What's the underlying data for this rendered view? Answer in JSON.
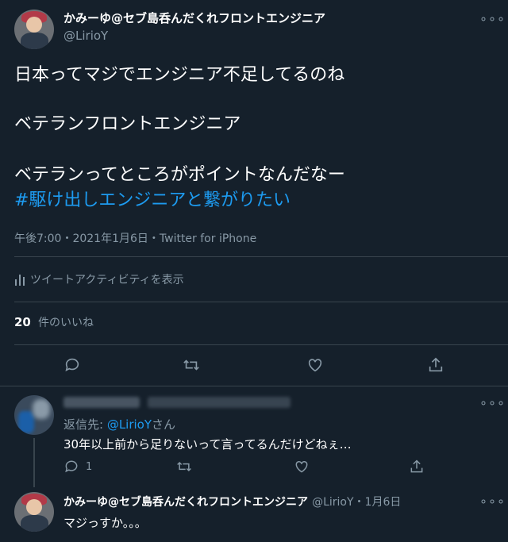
{
  "tweet": {
    "author_name": "かみーゆ@セブ島呑んだくれフロントエンジニア",
    "author_handle": "@LirioY",
    "more_icon": "more-horizontal-icon",
    "lines": [
      "日本ってマジでエンジニア不足してるのね",
      "ベテランフロントエンジニア",
      "ベテランってところがポイントなんだなー"
    ],
    "hashtag": "#駆け出しエンジニアと繋がりたい",
    "timestamp": "午後7:00・2021年1月6日・Twitter for iPhone",
    "activity_label": "ツイートアクティビティを表示",
    "likes_count": "20",
    "likes_label": "件のいいね"
  },
  "reply": {
    "reply_to_prefix": "返信先: ",
    "reply_to_handle": "@LirioY",
    "reply_to_suffix": "さん",
    "text": "30年以上前から足りないって言ってるんだけどねぇ…",
    "reply_count": "1"
  },
  "self_reply": {
    "author_name": "かみーゆ@セブ島呑んだくれフロントエンジニア",
    "author_handle": "@LirioY",
    "date": "・1月6日",
    "text": "マジっすか。。。"
  },
  "colors": {
    "background": "#15202b",
    "accent": "#1d9bf0",
    "muted": "#8899a6",
    "divider": "#38444d"
  }
}
